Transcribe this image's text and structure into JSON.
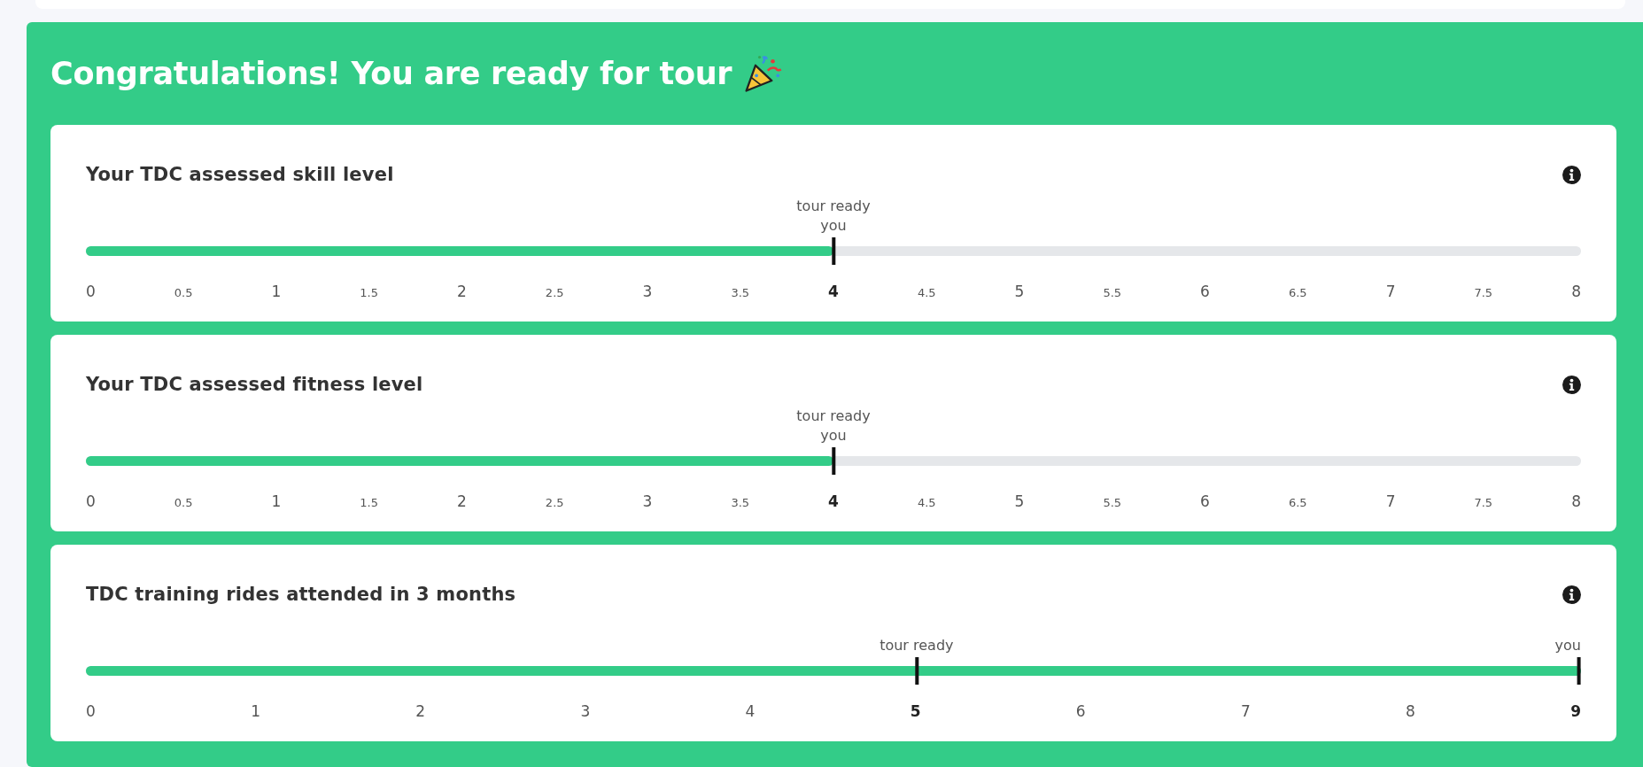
{
  "panel": {
    "title": "Congratulations! You are ready for tour"
  },
  "cards": [
    {
      "title": "Your TDC assessed skill level",
      "level": 0.5,
      "markers": [
        {
          "labels": [
            "tour ready",
            "you"
          ],
          "level": 0.5
        }
      ],
      "ticks": [
        {
          "label": "0",
          "kind": "major",
          "bold": false
        },
        {
          "label": "0.5",
          "kind": "minor",
          "bold": false
        },
        {
          "label": "1",
          "kind": "major",
          "bold": false
        },
        {
          "label": "1.5",
          "kind": "minor",
          "bold": false
        },
        {
          "label": "2",
          "kind": "major",
          "bold": false
        },
        {
          "label": "2.5",
          "kind": "minor",
          "bold": false
        },
        {
          "label": "3",
          "kind": "major",
          "bold": false
        },
        {
          "label": "3.5",
          "kind": "minor",
          "bold": false
        },
        {
          "label": "4",
          "kind": "major",
          "bold": true
        },
        {
          "label": "4.5",
          "kind": "minor",
          "bold": false
        },
        {
          "label": "5",
          "kind": "major",
          "bold": false
        },
        {
          "label": "5.5",
          "kind": "minor",
          "bold": false
        },
        {
          "label": "6",
          "kind": "major",
          "bold": false
        },
        {
          "label": "6.5",
          "kind": "minor",
          "bold": false
        },
        {
          "label": "7",
          "kind": "major",
          "bold": false
        },
        {
          "label": "7.5",
          "kind": "minor",
          "bold": false
        },
        {
          "label": "8",
          "kind": "major",
          "bold": false
        }
      ]
    },
    {
      "title": "Your TDC assessed fitness level",
      "level": 0.5,
      "markers": [
        {
          "labels": [
            "tour ready",
            "you"
          ],
          "level": 0.5
        }
      ],
      "ticks": [
        {
          "label": "0",
          "kind": "major",
          "bold": false
        },
        {
          "label": "0.5",
          "kind": "minor",
          "bold": false
        },
        {
          "label": "1",
          "kind": "major",
          "bold": false
        },
        {
          "label": "1.5",
          "kind": "minor",
          "bold": false
        },
        {
          "label": "2",
          "kind": "major",
          "bold": false
        },
        {
          "label": "2.5",
          "kind": "minor",
          "bold": false
        },
        {
          "label": "3",
          "kind": "major",
          "bold": false
        },
        {
          "label": "3.5",
          "kind": "minor",
          "bold": false
        },
        {
          "label": "4",
          "kind": "major",
          "bold": true
        },
        {
          "label": "4.5",
          "kind": "minor",
          "bold": false
        },
        {
          "label": "5",
          "kind": "major",
          "bold": false
        },
        {
          "label": "5.5",
          "kind": "minor",
          "bold": false
        },
        {
          "label": "6",
          "kind": "major",
          "bold": false
        },
        {
          "label": "6.5",
          "kind": "minor",
          "bold": false
        },
        {
          "label": "7",
          "kind": "major",
          "bold": false
        },
        {
          "label": "7.5",
          "kind": "minor",
          "bold": false
        },
        {
          "label": "8",
          "kind": "major",
          "bold": false
        }
      ]
    },
    {
      "title": "TDC training rides attended in 3 months",
      "level": 1,
      "markers": [
        {
          "labels": [
            "tour ready"
          ],
          "level": 0.5556
        },
        {
          "labels": [
            "you"
          ],
          "level": 1
        }
      ],
      "ticks": [
        {
          "label": "0",
          "kind": "major",
          "bold": false
        },
        {
          "label": "1",
          "kind": "major",
          "bold": false
        },
        {
          "label": "2",
          "kind": "major",
          "bold": false
        },
        {
          "label": "3",
          "kind": "major",
          "bold": false
        },
        {
          "label": "4",
          "kind": "major",
          "bold": false
        },
        {
          "label": "5",
          "kind": "major",
          "bold": true
        },
        {
          "label": "6",
          "kind": "major",
          "bold": false
        },
        {
          "label": "7",
          "kind": "major",
          "bold": false
        },
        {
          "label": "8",
          "kind": "major",
          "bold": false
        },
        {
          "label": "9",
          "kind": "major",
          "bold": true
        }
      ]
    }
  ]
}
